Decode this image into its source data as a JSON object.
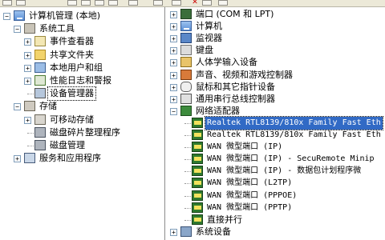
{
  "left_tree": [
    {
      "id": "root",
      "label": "计算机管理 (本地)",
      "icon": "computer-icon",
      "indent": 0,
      "expander": "minus"
    },
    {
      "id": "system-tools",
      "label": "系统工具",
      "icon": "tools-icon",
      "indent": 1,
      "expander": "minus"
    },
    {
      "id": "event-viewer",
      "label": "事件查看器",
      "icon": "event-viewer-icon",
      "indent": 2,
      "expander": "plus"
    },
    {
      "id": "shared-folders",
      "label": "共享文件夹",
      "icon": "shared-folder-icon",
      "indent": 2,
      "expander": "plus"
    },
    {
      "id": "local-users",
      "label": "本地用户和组",
      "icon": "users-icon",
      "indent": 2,
      "expander": "plus"
    },
    {
      "id": "perf-logs",
      "label": "性能日志和警报",
      "icon": "performance-icon",
      "indent": 2,
      "expander": "plus"
    },
    {
      "id": "device-manager",
      "label": "设备管理器",
      "icon": "device-manager-icon",
      "indent": 2,
      "expander": "none",
      "selected": true
    },
    {
      "id": "storage",
      "label": "存储",
      "icon": "storage-icon",
      "indent": 1,
      "expander": "minus"
    },
    {
      "id": "removable",
      "label": "可移动存储",
      "icon": "removable-storage-icon",
      "indent": 2,
      "expander": "plus"
    },
    {
      "id": "defrag",
      "label": "磁盘碎片整理程序",
      "icon": "defrag-icon",
      "indent": 2,
      "expander": "none"
    },
    {
      "id": "disk-mgmt",
      "label": "磁盘管理",
      "icon": "disk-management-icon",
      "indent": 2,
      "expander": "none"
    },
    {
      "id": "services",
      "label": "服务和应用程序",
      "icon": "services-icon",
      "indent": 1,
      "expander": "plus"
    }
  ],
  "device_tree": [
    {
      "id": "ports",
      "label": "端口 (COM 和 LPT)",
      "icon": "port-icon",
      "indent": 1,
      "expander": "plus"
    },
    {
      "id": "computer",
      "label": "计算机",
      "icon": "computer-icon",
      "indent": 1,
      "expander": "plus"
    },
    {
      "id": "monitor",
      "label": "监视器",
      "icon": "monitor-icon",
      "indent": 1,
      "expander": "plus"
    },
    {
      "id": "keyboard",
      "label": "键盘",
      "icon": "keyboard-icon",
      "indent": 1,
      "expander": "plus"
    },
    {
      "id": "hid",
      "label": "人体学输入设备",
      "icon": "hid-icon",
      "indent": 1,
      "expander": "plus"
    },
    {
      "id": "sound",
      "label": "声音、视频和游戏控制器",
      "icon": "sound-icon",
      "indent": 1,
      "expander": "plus"
    },
    {
      "id": "mouse",
      "label": "鼠标和其它指针设备",
      "icon": "mouse-icon",
      "indent": 1,
      "expander": "plus"
    },
    {
      "id": "usb",
      "label": "通用串行总线控制器",
      "icon": "usb-icon",
      "indent": 1,
      "expander": "plus"
    },
    {
      "id": "network",
      "label": "网络适配器",
      "icon": "network-adapter-icon",
      "indent": 1,
      "expander": "minus"
    },
    {
      "id": "nic-1",
      "label": "Realtek RTL8139/810x Family Fast Eth",
      "icon": "nic-icon",
      "indent": 2,
      "expander": "none",
      "mono": true,
      "selected": true
    },
    {
      "id": "nic-2",
      "label": "Realtek RTL8139/810x Family Fast Eth",
      "icon": "nic-icon",
      "indent": 2,
      "expander": "none",
      "mono": true
    },
    {
      "id": "wan-ip",
      "label": "WAN 微型端口 (IP)",
      "icon": "nic-icon",
      "indent": 2,
      "expander": "none",
      "mono": true
    },
    {
      "id": "wan-ip-secure",
      "label": "WAN 微型端口 (IP) - SecuRemote Minip",
      "icon": "nic-icon",
      "indent": 2,
      "expander": "none",
      "mono": true
    },
    {
      "id": "wan-ip-sched",
      "label": "WAN 微型端口 (IP) - 数据包计划程序微",
      "icon": "nic-icon",
      "indent": 2,
      "expander": "none",
      "mono": true
    },
    {
      "id": "wan-l2tp",
      "label": "WAN 微型端口 (L2TP)",
      "icon": "nic-icon",
      "indent": 2,
      "expander": "none",
      "mono": true
    },
    {
      "id": "wan-pppoe",
      "label": "WAN 微型端口 (PPPOE)",
      "icon": "nic-icon",
      "indent": 2,
      "expander": "none",
      "mono": true
    },
    {
      "id": "wan-pptp",
      "label": "WAN 微型端口 (PPTP)",
      "icon": "nic-icon",
      "indent": 2,
      "expander": "none",
      "mono": true
    },
    {
      "id": "parallel",
      "label": "直接并行",
      "icon": "nic-icon",
      "indent": 2,
      "expander": "none"
    },
    {
      "id": "system-devices",
      "label": "系统设备",
      "icon": "system-devices-icon",
      "indent": 1,
      "expander": "plus"
    }
  ],
  "colors": {
    "selection": "#316ac5",
    "toolbar": "#ece9d8",
    "divider": "#8c8c8c"
  }
}
